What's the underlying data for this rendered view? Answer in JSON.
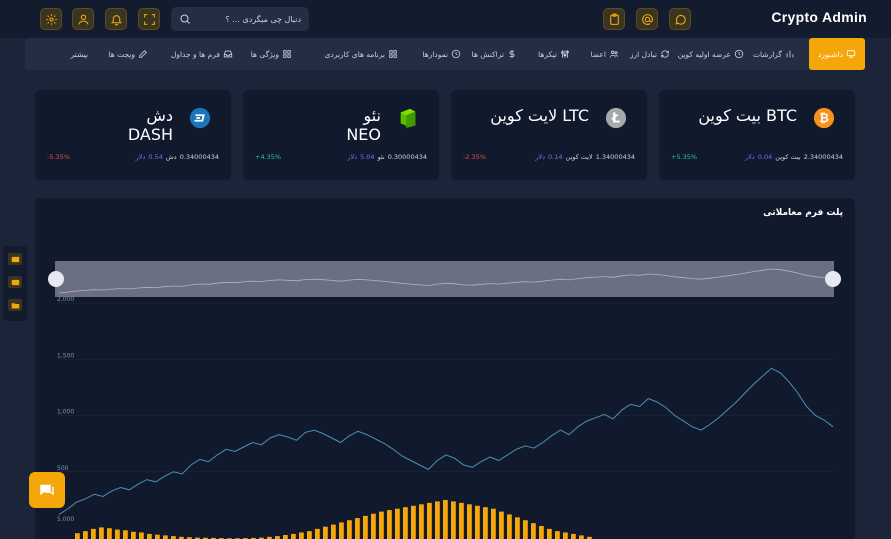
{
  "app": {
    "title": "Crypto Admin"
  },
  "search": {
    "placeholder": "دنبال چی میگردی ... ؟"
  },
  "topbar_icons": [
    "settings-icon",
    "user-icon",
    "bell-icon",
    "fullscreen-icon",
    "clipboard-icon",
    "at-icon",
    "chat-icon"
  ],
  "nav": {
    "active": "داشبورد",
    "items": [
      "گزارشات",
      "عرضه اولیه کوین",
      "تبادل ارز",
      "اعضا",
      "تیکرها",
      "تراکنش ها",
      "نمودارها",
      "برنامه های کاربردی",
      "ویژگی ها",
      "فرم ها و جداول",
      "ویجت ها",
      "بیشتر"
    ]
  },
  "cards": [
    {
      "name": "بیت کوین BTC",
      "amount": "2.34000434",
      "coin": "بیت کوین",
      "price": "0.04",
      "unit": "دلار",
      "pct": "+5.35%",
      "trend": "pos",
      "icon": "bitcoin-icon",
      "color": "#f7931a"
    },
    {
      "name": "لایت کوین LTC",
      "amount": "1.34000434",
      "coin": "لایت کوین",
      "price": "0.14",
      "unit": "دلار",
      "pct": "-2.35%",
      "trend": "neg",
      "icon": "litecoin-icon",
      "color": "#a6a9aa"
    },
    {
      "name_line1": "نئو",
      "name_line2": "NEO",
      "amount": "0.30000434",
      "coin": "نئو",
      "price": "5.04",
      "unit": "دلار",
      "pct": "+4.35%",
      "trend": "pos",
      "icon": "neo-icon",
      "color": "#58bf00"
    },
    {
      "name_line1": "دش",
      "name_line2": "DASH",
      "amount": "0.34000434",
      "coin": "دش",
      "price": "0.54",
      "unit": "دلار",
      "pct": "-5.35%",
      "trend": "neg",
      "icon": "dash-icon",
      "color": "#1c75bc"
    }
  ],
  "chart_data": {
    "type": "line",
    "title": "پلت فرم معاملاتی",
    "yticks": [
      "2,000",
      "1,500",
      "1,000",
      "500"
    ],
    "ylim": [
      0,
      2000
    ],
    "volume_ytick": "5,000",
    "values": [
      120,
      170,
      230,
      260,
      300,
      280,
      330,
      360,
      340,
      390,
      430,
      410,
      460,
      500,
      480,
      560,
      610,
      590,
      650,
      700,
      680,
      720,
      760,
      740,
      800,
      830,
      810,
      780,
      850,
      870,
      840,
      800,
      760,
      820,
      860,
      830,
      790,
      750,
      700,
      640,
      600,
      560,
      520,
      600,
      650,
      620,
      560,
      540,
      590,
      630,
      600,
      650,
      700,
      730,
      710,
      760,
      820,
      870,
      830,
      900,
      950,
      980,
      1010,
      970,
      1050,
      1100,
      1080,
      1150,
      1120,
      1070,
      1000,
      950,
      900,
      870,
      920,
      980,
      1050,
      1120,
      1200,
      1280,
      1350,
      1420,
      1380,
      1300,
      1200,
      1080,
      1000,
      960,
      900
    ],
    "volume": [
      80,
      110,
      140,
      160,
      150,
      130,
      120,
      100,
      90,
      70,
      60,
      50,
      40,
      30,
      25,
      20,
      18,
      15,
      12,
      10,
      10,
      12,
      15,
      20,
      30,
      40,
      55,
      70,
      90,
      110,
      140,
      170,
      200,
      230,
      260,
      290,
      320,
      350,
      380,
      400,
      420,
      440,
      460,
      480,
      500,
      520,
      540,
      520,
      500,
      480,
      460,
      440,
      420,
      380,
      340,
      300,
      260,
      220,
      180,
      140,
      110,
      90,
      70,
      50,
      30
    ]
  },
  "side_tabs": [
    "card-icon",
    "wallet-icon",
    "folder-icon"
  ]
}
